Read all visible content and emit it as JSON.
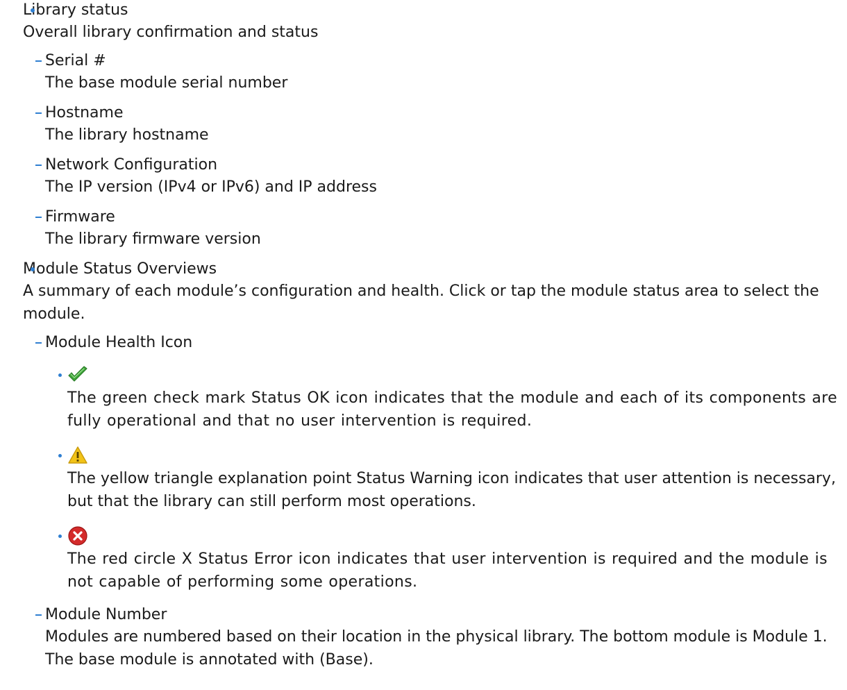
{
  "sections": [
    {
      "title": "Library status",
      "desc": "Overall library confirmation and status",
      "items": [
        {
          "title": "Serial #",
          "desc": "The base module serial number"
        },
        {
          "title": "Hostname",
          "desc": "The library hostname"
        },
        {
          "title": "Network Configuration",
          "desc": "The IP version (IPv4 or IPv6) and IP address"
        },
        {
          "title": "Firmware",
          "desc": "The library firmware version"
        }
      ]
    },
    {
      "title": "Module Status Overviews",
      "desc": "A summary of each module’s configuration and health. Click or tap the module status area to select the module.",
      "items": [
        {
          "title": "Module Health Icon",
          "icons": [
            {
              "icon": "green-check-icon",
              "color": "#3fa53a",
              "desc": "The green check mark Status OK icon indicates that the module and each of its components are fully operational and that no user intervention is required."
            },
            {
              "icon": "yellow-warning-icon",
              "color": "#f2c318",
              "desc": "The yellow triangle explanation point Status Warning icon indicates that user attention is necessary, but that the library can still perform most operations."
            },
            {
              "icon": "red-error-icon",
              "color": "#d42b2b",
              "desc": "The red circle X Status Error icon indicates that user intervention is required and the module is not capable of performing some operations."
            }
          ]
        },
        {
          "title": "Module Number",
          "desc": "Modules are numbered based on their location in the physical library. The bottom module is Module 1. The base module is annotated with (Base)."
        }
      ]
    }
  ],
  "colors": {
    "bullet": "#2f7fd1",
    "text": "#1a1a1a"
  }
}
